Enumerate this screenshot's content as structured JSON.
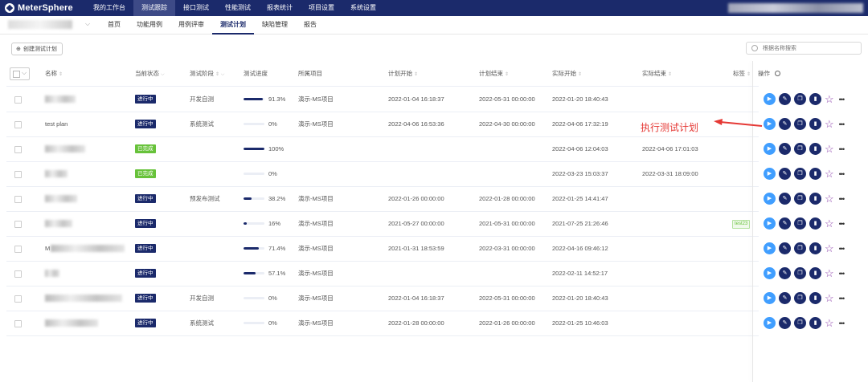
{
  "app": {
    "logo": "MeterSphere",
    "nav": [
      "我的工作台",
      "测试跟踪",
      "接口测试",
      "性能测试",
      "报表统计",
      "项目设置",
      "系统设置"
    ],
    "active_nav": 1
  },
  "subnav": {
    "items": [
      "首页",
      "功能用例",
      "用例评审",
      "测试计划",
      "缺陷管理",
      "报告"
    ],
    "active": 3
  },
  "toolbar": {
    "create_label": "创建测试计划",
    "search_placeholder": "根据名称搜索"
  },
  "columns": {
    "name": "名称",
    "status": "当前状态",
    "stage": "测试阶段",
    "progress": "测试进度",
    "project": "所属项目",
    "plan_start": "计划开始",
    "plan_end": "计划结束",
    "actual_start": "实际开始",
    "actual_end": "实际结束",
    "tags": "标签",
    "ops": "操作"
  },
  "rows": [
    {
      "name": "",
      "status": "进行中",
      "status_type": "run",
      "stage": "开发自测",
      "progress": 91.3,
      "progress_text": "91.3%",
      "project": "演示-MS项目",
      "plan_start": "2022-01-04 16:18:37",
      "plan_end": "2022-05-31 00:00:00",
      "actual_start": "2022-01-20 18:40:43",
      "actual_end": "",
      "tag": ""
    },
    {
      "name": "test plan",
      "status": "进行中",
      "status_type": "run",
      "stage": "系统测试",
      "progress": 0,
      "progress_text": "0%",
      "project": "演示-MS项目",
      "plan_start": "2022-04-06 16:53:36",
      "plan_end": "2022-04-30 00:00:00",
      "actual_start": "2022-04-06 17:32:19",
      "actual_end": "",
      "tag": ""
    },
    {
      "name": "",
      "status": "已完成",
      "status_type": "done",
      "stage": "",
      "progress": 100,
      "progress_text": "100%",
      "project": "",
      "plan_start": "",
      "plan_end": "",
      "actual_start": "2022-04-06 12:04:03",
      "actual_end": "2022-04-06 17:01:03",
      "tag": ""
    },
    {
      "name": "",
      "status": "已完成",
      "status_type": "done",
      "stage": "",
      "progress": 0,
      "progress_text": "0%",
      "project": "",
      "plan_start": "",
      "plan_end": "",
      "actual_start": "2022-03-23 15:03:37",
      "actual_end": "2022-03-31 18:09:00",
      "tag": ""
    },
    {
      "name": "",
      "status": "进行中",
      "status_type": "run",
      "stage": "预发布测试",
      "progress": 38.2,
      "progress_text": "38.2%",
      "project": "演示-MS项目",
      "plan_start": "2022-01-26 00:00:00",
      "plan_end": "2022-01-28 00:00:00",
      "actual_start": "2022-01-25 14:41:47",
      "actual_end": "",
      "tag": ""
    },
    {
      "name": "",
      "status": "进行中",
      "status_type": "run",
      "stage": "",
      "progress": 16,
      "progress_text": "16%",
      "project": "演示-MS项目",
      "plan_start": "2021-05-27 00:00:00",
      "plan_end": "2021-05-31 00:00:00",
      "actual_start": "2021-07-25 21:26:46",
      "actual_end": "",
      "tag": "test23"
    },
    {
      "name": "M",
      "status": "进行中",
      "status_type": "run",
      "stage": "",
      "progress": 71.4,
      "progress_text": "71.4%",
      "project": "演示-MS项目",
      "plan_start": "2021-01-31 18:53:59",
      "plan_end": "2022-03-31 00:00:00",
      "actual_start": "2022-04-16 09:46:12",
      "actual_end": "",
      "tag": ""
    },
    {
      "name": "",
      "status": "进行中",
      "status_type": "run",
      "stage": "",
      "progress": 57.1,
      "progress_text": "57.1%",
      "project": "演示-MS项目",
      "plan_start": "",
      "plan_end": "",
      "actual_start": "2022-02-11 14:52:17",
      "actual_end": "",
      "tag": ""
    },
    {
      "name": "",
      "status": "进行中",
      "status_type": "run",
      "stage": "开发自测",
      "progress": 0,
      "progress_text": "0%",
      "project": "演示-MS项目",
      "plan_start": "2022-01-04 16:18:37",
      "plan_end": "2022-05-31 00:00:00",
      "actual_start": "2022-01-20 18:40:43",
      "actual_end": "",
      "tag": ""
    },
    {
      "name": "",
      "status": "进行中",
      "status_type": "run",
      "stage": "系统测试",
      "progress": 0,
      "progress_text": "0%",
      "project": "演示-MS项目",
      "plan_start": "2022-01-28 00:00:00",
      "plan_end": "2022-01-26 00:00:00",
      "actual_start": "2022-01-25 10:46:03",
      "actual_end": "",
      "tag": ""
    }
  ],
  "annotation": "执行测试计划",
  "colors": {
    "primary": "#1b2a6b",
    "exec": "#409eff",
    "done": "#67c23a",
    "star": "#8e44ad",
    "annotation": "#e53935"
  }
}
